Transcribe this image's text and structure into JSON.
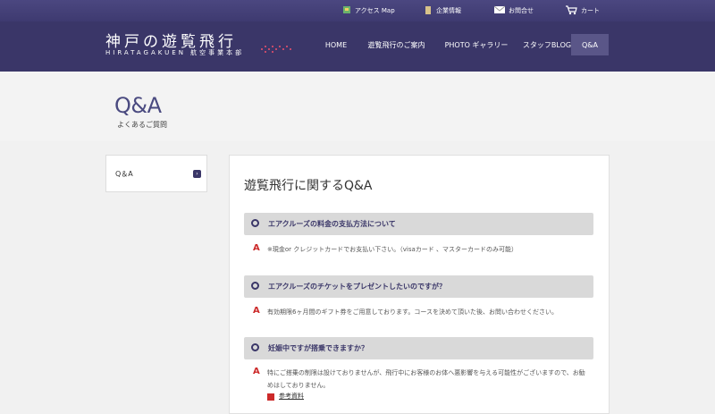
{
  "utility": {
    "access": "アクセス Map",
    "company": "企業情報",
    "contact": "お問合せ",
    "cart": "カート"
  },
  "logo": {
    "title": "神戸の遊覧飛行",
    "subtitle": "HIRATAGAKUEN 航空事業本部"
  },
  "nav": {
    "home": "HOME",
    "guide": "遊覧飛行のご案内",
    "photo": "PHOTO ギャラリー",
    "blog": "スタッフBLOG",
    "qa": "Q&A"
  },
  "page": {
    "title": "Q&A",
    "subtitle": "よくあるご質問"
  },
  "sidebar": {
    "item": "Q＆A"
  },
  "content": {
    "heading": "遊覧飛行に関するQ&A",
    "items": [
      {
        "q": "エアクルーズの料金の支払方法について",
        "a": "※現金or クレジットカードでお支払い下さい。（visaカード 、マスターカードのみ可能）"
      },
      {
        "q": "エアクルーズのチケットをプレゼントしたいのですが？",
        "a": "有効期限6ヶ月間のギフト券をご用意しております。コースを決めて頂いた後、お問い合わせください。"
      },
      {
        "q": "妊娠中ですが搭乗できますか？",
        "a": "特にご搭乗の制限は設けておりませんが、飛行中にお客様のお体へ悪影響を与える可能性がございますので、お勧めはしておりません。"
      }
    ],
    "ref_link": "参考資料"
  },
  "colors": {
    "header": "#3a3668",
    "accent": "#cc2a2a"
  }
}
